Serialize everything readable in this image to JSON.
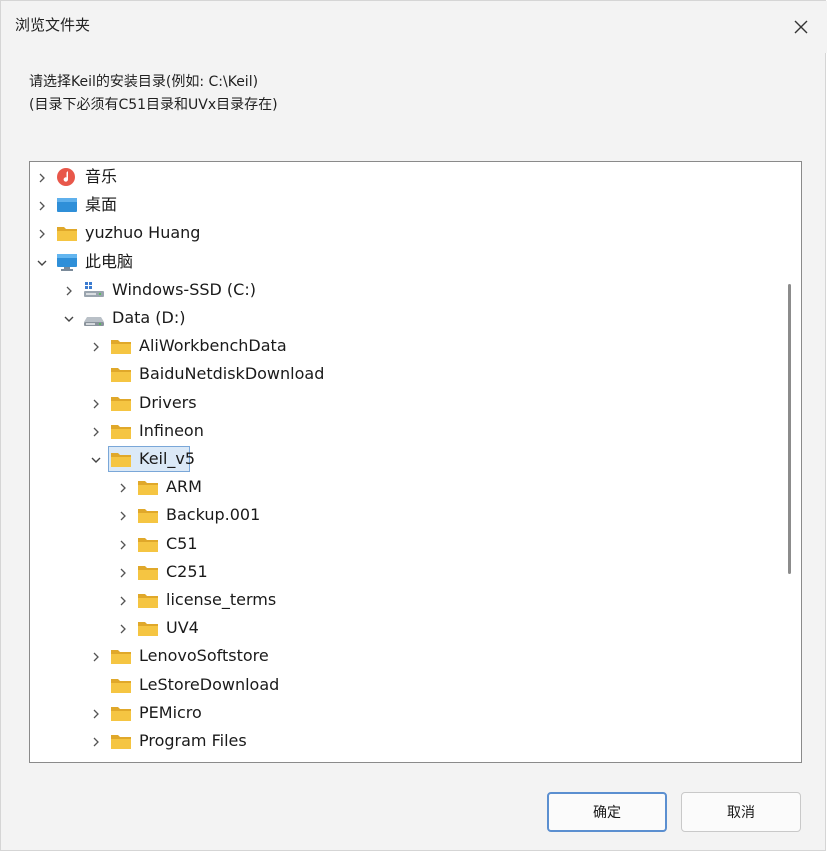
{
  "dialog": {
    "title": "浏览文件夹",
    "instruction_line1": "请选择Keil的安装目录(例如: C:\\Keil)",
    "instruction_line2": "(目录下必须有C51目录和UVx目录存在)"
  },
  "tree": {
    "items": [
      {
        "label": "音乐",
        "icon": "music-icon",
        "state": "collapsed",
        "level": 0
      },
      {
        "label": "桌面",
        "icon": "desktop-icon",
        "state": "collapsed",
        "level": 0
      },
      {
        "label": "yuzhuo Huang",
        "icon": "user-folder-icon",
        "state": "collapsed",
        "level": 0
      },
      {
        "label": "此电脑",
        "icon": "computer-icon",
        "state": "expanded",
        "level": 0
      },
      {
        "label": "Windows-SSD (C:)",
        "icon": "system-drive-icon",
        "state": "collapsed",
        "level": 1
      },
      {
        "label": "Data (D:)",
        "icon": "drive-icon",
        "state": "expanded",
        "level": 1
      },
      {
        "label": "AliWorkbenchData",
        "icon": "folder-icon",
        "state": "collapsed",
        "level": 2
      },
      {
        "label": "BaiduNetdiskDownload",
        "icon": "folder-icon",
        "state": "none",
        "level": 2
      },
      {
        "label": "Drivers",
        "icon": "folder-icon",
        "state": "collapsed",
        "level": 2
      },
      {
        "label": "Infineon",
        "icon": "folder-icon",
        "state": "collapsed",
        "level": 2
      },
      {
        "label": "Keil_v5",
        "icon": "folder-icon",
        "state": "expanded",
        "level": 2,
        "selected": true
      },
      {
        "label": "ARM",
        "icon": "folder-icon",
        "state": "collapsed",
        "level": 3
      },
      {
        "label": "Backup.001",
        "icon": "folder-icon",
        "state": "collapsed",
        "level": 3
      },
      {
        "label": "C51",
        "icon": "folder-icon",
        "state": "collapsed",
        "level": 3
      },
      {
        "label": "C251",
        "icon": "folder-icon",
        "state": "collapsed",
        "level": 3
      },
      {
        "label": "license_terms",
        "icon": "folder-icon",
        "state": "collapsed",
        "level": 3
      },
      {
        "label": "UV4",
        "icon": "folder-icon",
        "state": "collapsed",
        "level": 3
      },
      {
        "label": "LenovoSoftstore",
        "icon": "folder-icon",
        "state": "collapsed",
        "level": 2
      },
      {
        "label": "LeStoreDownload",
        "icon": "folder-icon",
        "state": "none",
        "level": 2
      },
      {
        "label": "PEMicro",
        "icon": "folder-icon",
        "state": "collapsed",
        "level": 2
      },
      {
        "label": "Program Files",
        "icon": "folder-icon",
        "state": "collapsed",
        "level": 2
      }
    ]
  },
  "buttons": {
    "ok_label": "确定",
    "cancel_label": "取消"
  },
  "colors": {
    "folder": "#f5c542",
    "folder_dark": "#e0a82a",
    "selection_border": "#7aa7d8",
    "selection_fill": "#dbe9f7",
    "ok_border": "#5b8fd0"
  }
}
